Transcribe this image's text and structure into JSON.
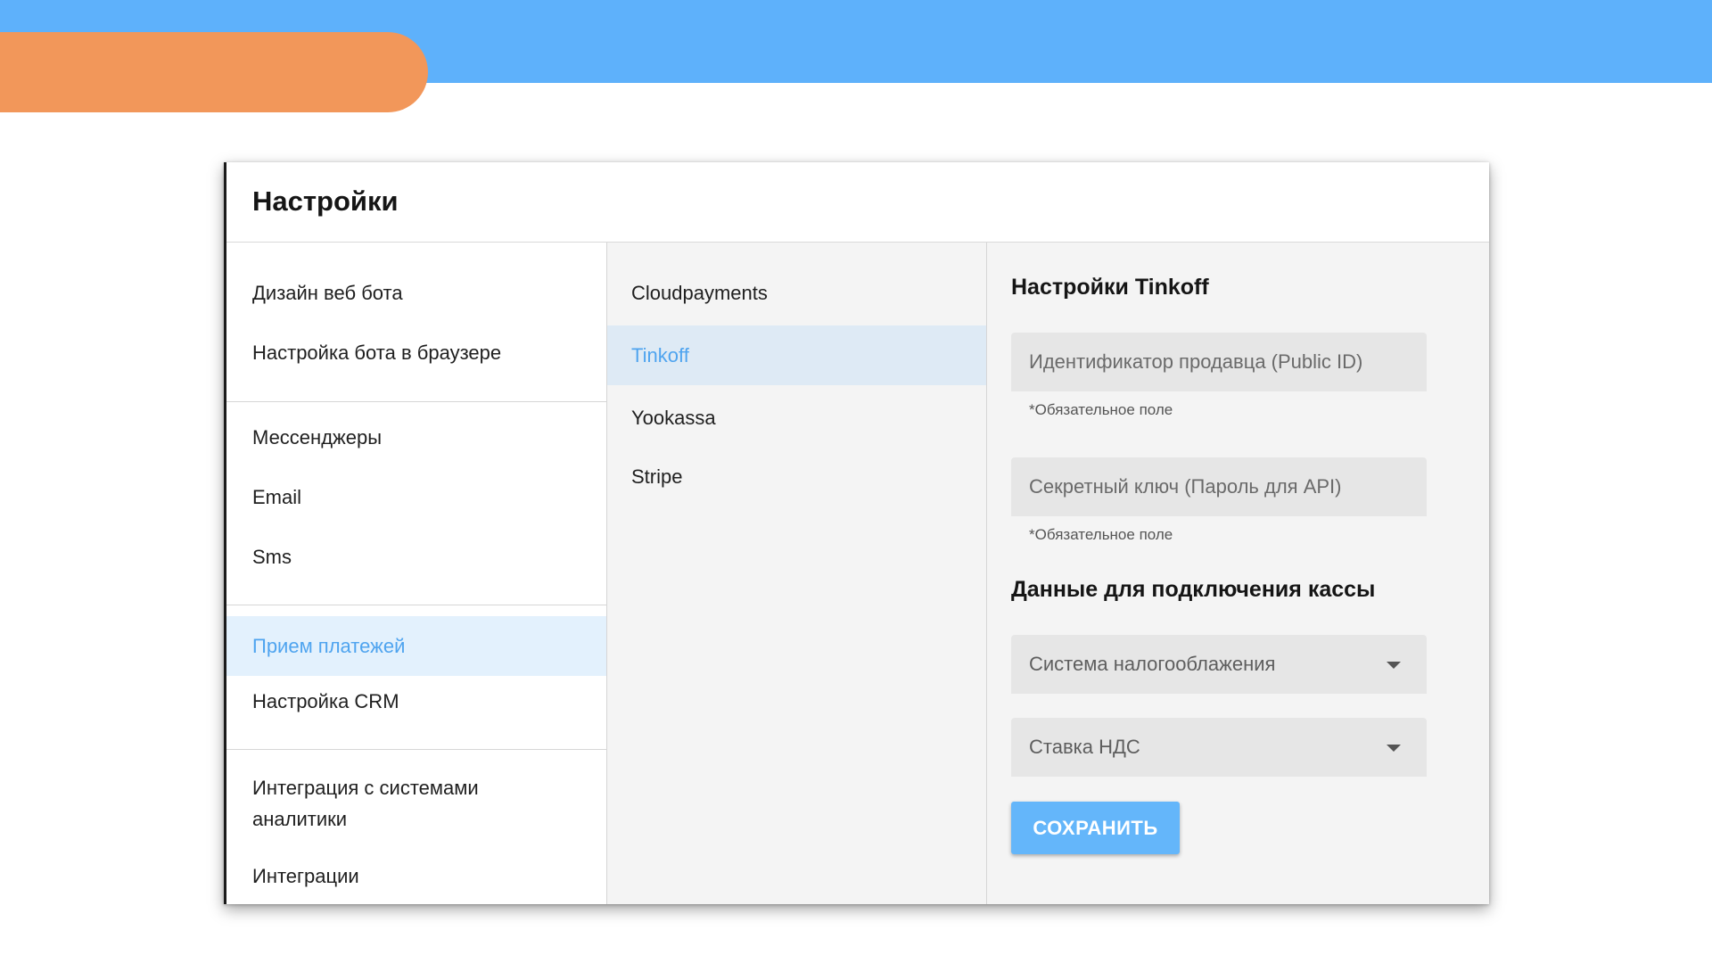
{
  "settings": {
    "title": "Настройки"
  },
  "left_menu": {
    "items": [
      {
        "label": "Дизайн веб бота"
      },
      {
        "label": "Настройка бота в браузере"
      },
      {
        "label": "Мессенджеры"
      },
      {
        "label": "Email"
      },
      {
        "label": "Sms"
      },
      {
        "label": "Прием платежей",
        "active": true
      },
      {
        "label": "Настройка CRM"
      },
      {
        "label": "Интеграция с системами аналитики"
      },
      {
        "label": "Интеграции"
      }
    ]
  },
  "payment_providers": {
    "items": [
      {
        "label": "Cloudpayments"
      },
      {
        "label": "Tinkoff",
        "active": true
      },
      {
        "label": "Yookassa"
      },
      {
        "label": "Stripe"
      }
    ]
  },
  "tinkoff_form": {
    "title": "Настройки Tinkoff",
    "merchant_id": {
      "placeholder": "Идентификатор продавца (Public ID)",
      "value": "",
      "hint": "*Обязательное поле"
    },
    "secret_key": {
      "placeholder": "Секретный ключ (Пароль для API)",
      "value": "",
      "hint": "*Обязательное поле"
    },
    "cashbox_title": "Данные для подключения кассы",
    "tax_system": {
      "label": "Система налогооблажения"
    },
    "vat_rate": {
      "label": "Ставка НДС"
    },
    "save_label": "СОХРАНИТЬ"
  },
  "colors": {
    "banner": "#5eb1fb",
    "accent_orange": "#f2975a",
    "active_text": "#4fa4ef",
    "save_button": "#64b6fa"
  }
}
